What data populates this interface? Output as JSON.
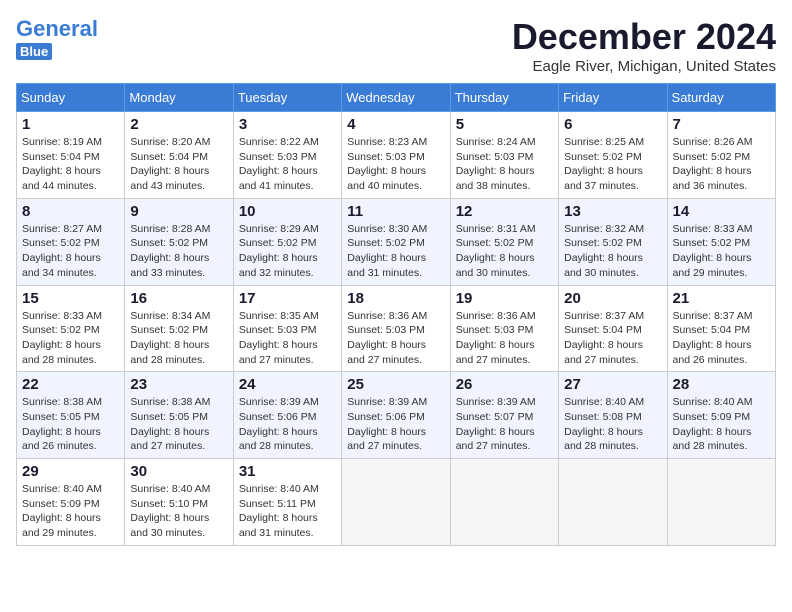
{
  "header": {
    "logo_general": "General",
    "logo_blue": "Blue",
    "month": "December 2024",
    "location": "Eagle River, Michigan, United States"
  },
  "days_of_week": [
    "Sunday",
    "Monday",
    "Tuesday",
    "Wednesday",
    "Thursday",
    "Friday",
    "Saturday"
  ],
  "weeks": [
    [
      {
        "day": 1,
        "info": "Sunrise: 8:19 AM\nSunset: 5:04 PM\nDaylight: 8 hours\nand 44 minutes."
      },
      {
        "day": 2,
        "info": "Sunrise: 8:20 AM\nSunset: 5:04 PM\nDaylight: 8 hours\nand 43 minutes."
      },
      {
        "day": 3,
        "info": "Sunrise: 8:22 AM\nSunset: 5:03 PM\nDaylight: 8 hours\nand 41 minutes."
      },
      {
        "day": 4,
        "info": "Sunrise: 8:23 AM\nSunset: 5:03 PM\nDaylight: 8 hours\nand 40 minutes."
      },
      {
        "day": 5,
        "info": "Sunrise: 8:24 AM\nSunset: 5:03 PM\nDaylight: 8 hours\nand 38 minutes."
      },
      {
        "day": 6,
        "info": "Sunrise: 8:25 AM\nSunset: 5:02 PM\nDaylight: 8 hours\nand 37 minutes."
      },
      {
        "day": 7,
        "info": "Sunrise: 8:26 AM\nSunset: 5:02 PM\nDaylight: 8 hours\nand 36 minutes."
      }
    ],
    [
      {
        "day": 8,
        "info": "Sunrise: 8:27 AM\nSunset: 5:02 PM\nDaylight: 8 hours\nand 34 minutes."
      },
      {
        "day": 9,
        "info": "Sunrise: 8:28 AM\nSunset: 5:02 PM\nDaylight: 8 hours\nand 33 minutes."
      },
      {
        "day": 10,
        "info": "Sunrise: 8:29 AM\nSunset: 5:02 PM\nDaylight: 8 hours\nand 32 minutes."
      },
      {
        "day": 11,
        "info": "Sunrise: 8:30 AM\nSunset: 5:02 PM\nDaylight: 8 hours\nand 31 minutes."
      },
      {
        "day": 12,
        "info": "Sunrise: 8:31 AM\nSunset: 5:02 PM\nDaylight: 8 hours\nand 30 minutes."
      },
      {
        "day": 13,
        "info": "Sunrise: 8:32 AM\nSunset: 5:02 PM\nDaylight: 8 hours\nand 30 minutes."
      },
      {
        "day": 14,
        "info": "Sunrise: 8:33 AM\nSunset: 5:02 PM\nDaylight: 8 hours\nand 29 minutes."
      }
    ],
    [
      {
        "day": 15,
        "info": "Sunrise: 8:33 AM\nSunset: 5:02 PM\nDaylight: 8 hours\nand 28 minutes."
      },
      {
        "day": 16,
        "info": "Sunrise: 8:34 AM\nSunset: 5:02 PM\nDaylight: 8 hours\nand 28 minutes."
      },
      {
        "day": 17,
        "info": "Sunrise: 8:35 AM\nSunset: 5:03 PM\nDaylight: 8 hours\nand 27 minutes."
      },
      {
        "day": 18,
        "info": "Sunrise: 8:36 AM\nSunset: 5:03 PM\nDaylight: 8 hours\nand 27 minutes."
      },
      {
        "day": 19,
        "info": "Sunrise: 8:36 AM\nSunset: 5:03 PM\nDaylight: 8 hours\nand 27 minutes."
      },
      {
        "day": 20,
        "info": "Sunrise: 8:37 AM\nSunset: 5:04 PM\nDaylight: 8 hours\nand 27 minutes."
      },
      {
        "day": 21,
        "info": "Sunrise: 8:37 AM\nSunset: 5:04 PM\nDaylight: 8 hours\nand 26 minutes."
      }
    ],
    [
      {
        "day": 22,
        "info": "Sunrise: 8:38 AM\nSunset: 5:05 PM\nDaylight: 8 hours\nand 26 minutes."
      },
      {
        "day": 23,
        "info": "Sunrise: 8:38 AM\nSunset: 5:05 PM\nDaylight: 8 hours\nand 27 minutes."
      },
      {
        "day": 24,
        "info": "Sunrise: 8:39 AM\nSunset: 5:06 PM\nDaylight: 8 hours\nand 28 minutes."
      },
      {
        "day": 25,
        "info": "Sunrise: 8:39 AM\nSunset: 5:06 PM\nDaylight: 8 hours\nand 27 minutes."
      },
      {
        "day": 26,
        "info": "Sunrise: 8:39 AM\nSunset: 5:07 PM\nDaylight: 8 hours\nand 27 minutes."
      },
      {
        "day": 27,
        "info": "Sunrise: 8:40 AM\nSunset: 5:08 PM\nDaylight: 8 hours\nand 28 minutes."
      },
      {
        "day": 28,
        "info": "Sunrise: 8:40 AM\nSunset: 5:09 PM\nDaylight: 8 hours\nand 28 minutes."
      }
    ],
    [
      {
        "day": 29,
        "info": "Sunrise: 8:40 AM\nSunset: 5:09 PM\nDaylight: 8 hours\nand 29 minutes."
      },
      {
        "day": 30,
        "info": "Sunrise: 8:40 AM\nSunset: 5:10 PM\nDaylight: 8 hours\nand 30 minutes."
      },
      {
        "day": 31,
        "info": "Sunrise: 8:40 AM\nSunset: 5:11 PM\nDaylight: 8 hours\nand 31 minutes."
      },
      null,
      null,
      null,
      null
    ]
  ]
}
